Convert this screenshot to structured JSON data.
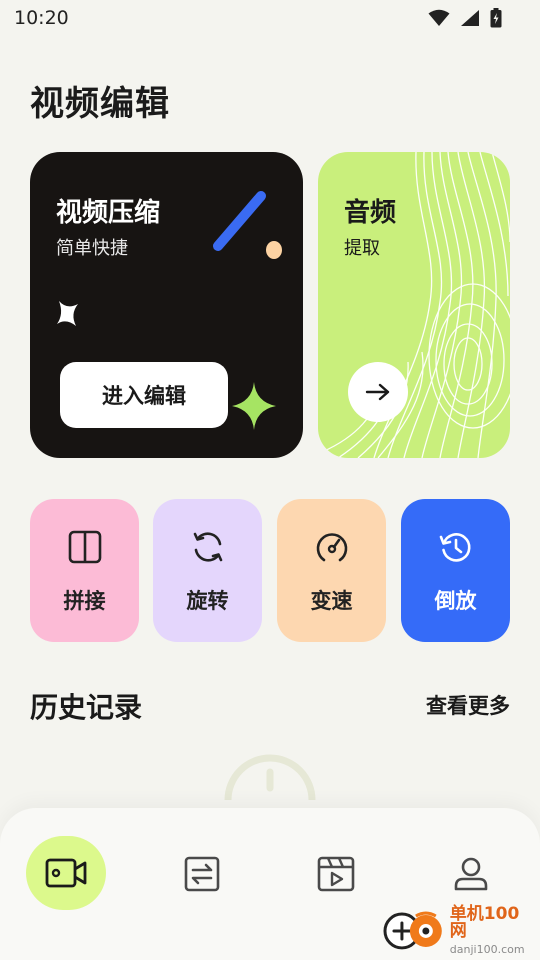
{
  "status_bar": {
    "time": "10:20",
    "icons": [
      "wifi-icon",
      "signal-icon",
      "battery-charging-icon"
    ]
  },
  "page": {
    "title": "视频编辑"
  },
  "compress_card": {
    "title": "视频压缩",
    "subtitle": "简单快捷",
    "button_label": "进入编辑",
    "bg_color": "#171412"
  },
  "audio_card": {
    "title": "音频",
    "subtitle": "提取",
    "bg_color": "#c9ef7c",
    "icon": "arrow-right-icon"
  },
  "tools": [
    {
      "label": "拼接",
      "icon": "split-panel-icon",
      "color": "#fcbbd6"
    },
    {
      "label": "旋转",
      "icon": "rotate-icon",
      "color": "#e4d6fc"
    },
    {
      "label": "变速",
      "icon": "speedometer-icon",
      "color": "#fdd7b0"
    },
    {
      "label": "倒放",
      "icon": "history-icon",
      "color": "#356bf8"
    }
  ],
  "history": {
    "title": "历史记录",
    "more_label": "查看更多"
  },
  "bottom_nav": [
    {
      "icon": "video-camera-icon",
      "active": true
    },
    {
      "icon": "convert-icon",
      "active": false
    },
    {
      "icon": "film-play-icon",
      "active": false
    },
    {
      "icon": "user-icon",
      "active": false
    }
  ],
  "watermark": {
    "name": "单机100网",
    "url": "danji100.com"
  }
}
